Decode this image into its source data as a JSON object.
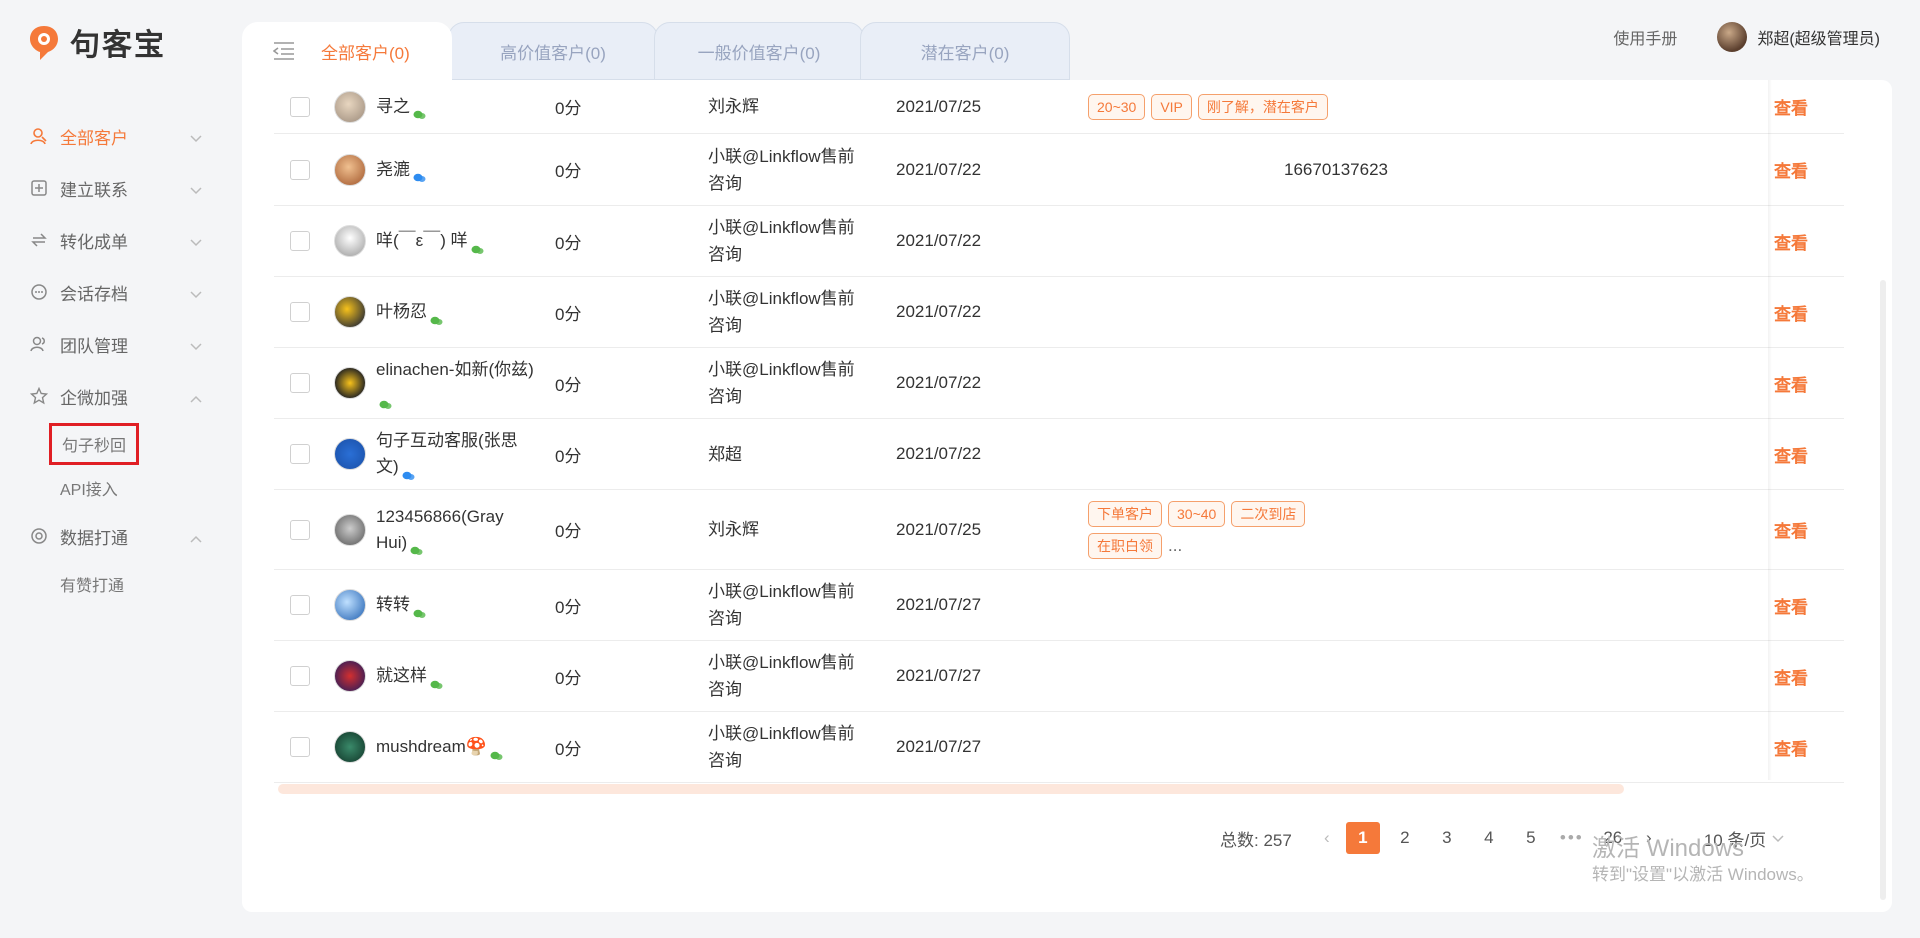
{
  "app": {
    "name": "句客宝"
  },
  "header": {
    "manual_label": "使用手册",
    "user_name": "郑超(超级管理员)"
  },
  "sidebar": {
    "items": [
      {
        "label": "全部客户",
        "icon": "customer-icon",
        "active": true,
        "expanded": false
      },
      {
        "label": "建立联系",
        "icon": "plus-square-icon",
        "active": false,
        "expanded": false
      },
      {
        "label": "转化成单",
        "icon": "convert-icon",
        "active": false,
        "expanded": false
      },
      {
        "label": "会话存档",
        "icon": "chat-icon",
        "active": false,
        "expanded": false
      },
      {
        "label": "团队管理",
        "icon": "team-icon",
        "active": false,
        "expanded": false
      },
      {
        "label": "企微加强",
        "icon": "star-icon",
        "active": false,
        "expanded": true,
        "children": [
          "句子秒回",
          "API接入"
        ]
      },
      {
        "label": "数据打通",
        "icon": "data-icon",
        "active": false,
        "expanded": true,
        "children": [
          "有赞打通"
        ]
      }
    ]
  },
  "tabs": [
    {
      "label": "全部客户(0)",
      "active": true
    },
    {
      "label": "高价值客户(0)",
      "active": false
    },
    {
      "label": "一般价值客户(0)",
      "active": false
    },
    {
      "label": "潜在客户(0)",
      "active": false
    }
  ],
  "table": {
    "view_label": "查看",
    "rows": [
      {
        "name": "寻之",
        "channel": "wechat",
        "score": "0分",
        "owner": "刘永辉",
        "date": "2021/07/25",
        "tags": [
          "20~30",
          "VIP",
          "刚了解，潜在客户"
        ],
        "tags_more": "",
        "phone": ""
      },
      {
        "name": "尧漉",
        "channel": "wework",
        "score": "0分",
        "owner": "小联@Linkflow售前咨询",
        "date": "2021/07/22",
        "tags": [],
        "tags_more": "",
        "phone": "16670137623"
      },
      {
        "name": "咩(￣ε￣) 咩",
        "channel": "wechat",
        "score": "0分",
        "owner": "小联@Linkflow售前咨询",
        "date": "2021/07/22",
        "tags": [],
        "tags_more": "",
        "phone": ""
      },
      {
        "name": "叶杨忍",
        "channel": "wechat",
        "score": "0分",
        "owner": "小联@Linkflow售前咨询",
        "date": "2021/07/22",
        "tags": [],
        "tags_more": "",
        "phone": ""
      },
      {
        "name": "elinachen-如新(你兹)",
        "channel": "wechat",
        "score": "0分",
        "owner": "小联@Linkflow售前咨询",
        "date": "2021/07/22",
        "tags": [],
        "tags_more": "",
        "phone": ""
      },
      {
        "name": "句子互动客服(张思文)",
        "channel": "wework",
        "score": "0分",
        "owner": "郑超",
        "date": "2021/07/22",
        "tags": [],
        "tags_more": "",
        "phone": ""
      },
      {
        "name": "123456866(Gray Hui)",
        "channel": "wechat",
        "score": "0分",
        "owner": "刘永辉",
        "date": "2021/07/25",
        "tags": [
          "下单客户",
          "30~40",
          "二次到店",
          "在职白领"
        ],
        "tags_more": "...",
        "phone": ""
      },
      {
        "name": "转转",
        "channel": "wechat",
        "score": "0分",
        "owner": "小联@Linkflow售前咨询",
        "date": "2021/07/27",
        "tags": [],
        "tags_more": "",
        "phone": ""
      },
      {
        "name": "就这样",
        "channel": "wechat",
        "score": "0分",
        "owner": "小联@Linkflow售前咨询",
        "date": "2021/07/27",
        "tags": [],
        "tags_more": "",
        "phone": ""
      },
      {
        "name": "mushdream🍄",
        "channel": "wechat",
        "score": "0分",
        "owner": "小联@Linkflow售前咨询",
        "date": "2021/07/27",
        "tags": [],
        "tags_more": "",
        "phone": ""
      }
    ]
  },
  "pagination": {
    "total_label": "总数: 257",
    "pages": [
      "1",
      "2",
      "3",
      "4",
      "5"
    ],
    "current": "1",
    "dots": "•••",
    "last_page": "26",
    "page_size": "10 条/页"
  },
  "watermark": {
    "line1": "激活 Windows",
    "line2": "转到\"设置\"以激活 Windows。"
  },
  "colors": {
    "accent": "#f5793a",
    "highlight_box": "#e01e24"
  }
}
